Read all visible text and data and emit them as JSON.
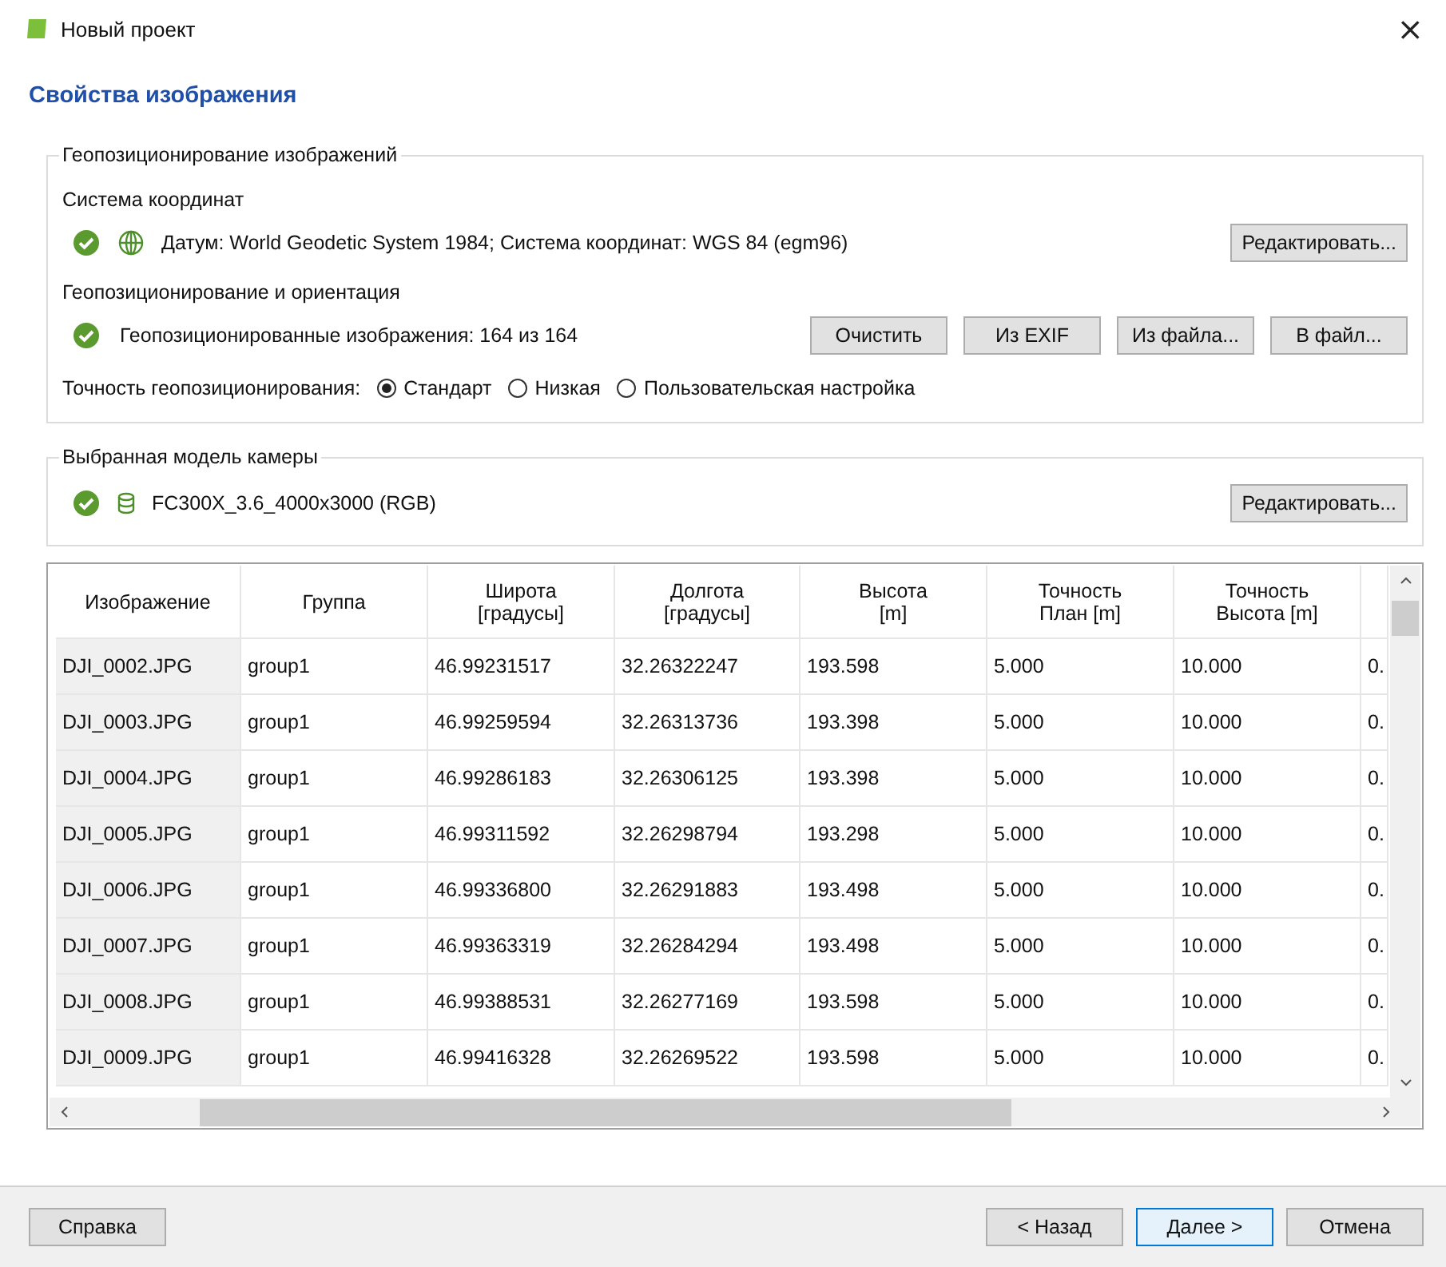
{
  "window": {
    "title": "Новый проект",
    "close": "×"
  },
  "page_title": "Свойства изображения",
  "geo_group": {
    "legend": "Геопозиционирование изображений",
    "crs_label": "Система координат",
    "crs_text": "Датум: World Geodetic System 1984; Система координат: WGS 84 (egm96)",
    "crs_ok": true,
    "crs_button": "Редактировать...",
    "orient_label": "Геопозиционирование и ориентация",
    "orient_ok": true,
    "orient_text": "Геопозиционированные изображения: 164 из 164",
    "orient_buttons": [
      "Очистить",
      "Из EXIF",
      "Из файла...",
      "В файл..."
    ],
    "accuracy_label": "Точность геопозиционирования:",
    "accuracy_options": [
      {
        "label": "Стандарт",
        "selected": true
      },
      {
        "label": "Низкая",
        "selected": false
      },
      {
        "label": "Пользовательская настройка",
        "selected": false
      }
    ]
  },
  "camera_group": {
    "legend": "Выбранная модель камеры",
    "ok": true,
    "model": "FC300X_3.6_4000x3000 (RGB)",
    "button": "Редактировать..."
  },
  "table": {
    "columns": [
      "Изображение",
      "Группа",
      "Широта\n[градусы]",
      "Долгота\n[градусы]",
      "Высота\n[m]",
      "Точность\nПлан [m]",
      "Точность\nВысота [m]",
      ""
    ],
    "rows": [
      [
        "DJI_0002.JPG",
        "group1",
        "46.99231517",
        "32.26322247",
        "193.598",
        "5.000",
        "10.000",
        "0."
      ],
      [
        "DJI_0003.JPG",
        "group1",
        "46.99259594",
        "32.26313736",
        "193.398",
        "5.000",
        "10.000",
        "0."
      ],
      [
        "DJI_0004.JPG",
        "group1",
        "46.99286183",
        "32.26306125",
        "193.398",
        "5.000",
        "10.000",
        "0."
      ],
      [
        "DJI_0005.JPG",
        "group1",
        "46.99311592",
        "32.26298794",
        "193.298",
        "5.000",
        "10.000",
        "0."
      ],
      [
        "DJI_0006.JPG",
        "group1",
        "46.99336800",
        "32.26291883",
        "193.498",
        "5.000",
        "10.000",
        "0."
      ],
      [
        "DJI_0007.JPG",
        "group1",
        "46.99363319",
        "32.26284294",
        "193.498",
        "5.000",
        "10.000",
        "0."
      ],
      [
        "DJI_0008.JPG",
        "group1",
        "46.99388531",
        "32.26277169",
        "193.598",
        "5.000",
        "10.000",
        "0."
      ],
      [
        "DJI_0009.JPG",
        "group1",
        "46.99416328",
        "32.26269522",
        "193.598",
        "5.000",
        "10.000",
        "0."
      ]
    ]
  },
  "footer": {
    "help": "Справка",
    "back": "< Назад",
    "next": "Далее >",
    "cancel": "Отмена"
  }
}
